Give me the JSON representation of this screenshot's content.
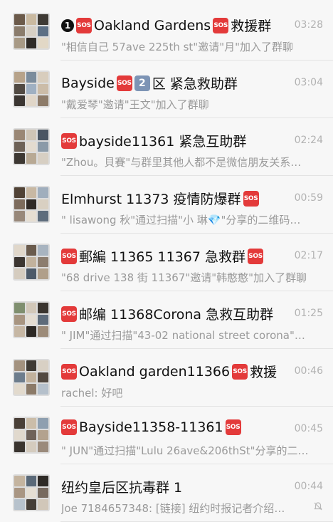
{
  "chats": [
    {
      "title_parts": [
        {
          "k": "circle",
          "t": "1"
        },
        {
          "k": "sos",
          "t": "SOS"
        },
        {
          "k": "text",
          "t": " Oakland Gardens"
        },
        {
          "k": "sos",
          "t": "SOS"
        },
        {
          "k": "text",
          "t": "救援群"
        }
      ],
      "preview": "\"相信自己 57ave 225th st\"邀请\"月\"加入了群聊",
      "time": "03:28"
    },
    {
      "title_parts": [
        {
          "k": "text",
          "t": "Bayside"
        },
        {
          "k": "sos",
          "t": "SOS"
        },
        {
          "k": "box",
          "t": "2"
        },
        {
          "k": "text",
          "t": "区 紧急救助群"
        }
      ],
      "preview": "\"戴爱琴\"邀请\"王文\"加入了群聊",
      "time": "03:04"
    },
    {
      "title_parts": [
        {
          "k": "sos",
          "t": "SOS"
        },
        {
          "k": "text",
          "t": "bayside11361 紧急互助群"
        }
      ],
      "preview": "\"Zhou。貝賽\"与群里其他人都不是微信朋友关系…",
      "time": "02:24"
    },
    {
      "title_parts": [
        {
          "k": "text",
          "t": "Elmhurst 11373 疫情防爆群"
        },
        {
          "k": "sos",
          "t": "SOS"
        }
      ],
      "preview": "\" lisawong 秋\"通过扫描\"小 琳💎\"分享的二维码…",
      "time": "00:59"
    },
    {
      "title_parts": [
        {
          "k": "sos",
          "t": "SOS"
        },
        {
          "k": "text",
          "t": "郵編 11365 11367 急救群"
        },
        {
          "k": "sos",
          "t": "SOS"
        }
      ],
      "preview": "\"68 drive 138 街 11367\"邀请\"韩憨憨\"加入了群聊",
      "time": "02:17"
    },
    {
      "title_parts": [
        {
          "k": "sos",
          "t": "SOS"
        },
        {
          "k": "text",
          "t": " 邮编 11368Corona 急救互助群"
        }
      ],
      "preview": "\" JIM\"通过扫描\"43-02 national street corona\"…",
      "time": "01:25"
    },
    {
      "title_parts": [
        {
          "k": "sos",
          "t": "SOS"
        },
        {
          "k": "text",
          "t": " Oakland garden11366"
        },
        {
          "k": "sos",
          "t": "SOS"
        },
        {
          "k": "text",
          "t": "救援"
        }
      ],
      "preview": "rachel: 好吧",
      "time": "00:46"
    },
    {
      "title_parts": [
        {
          "k": "sos",
          "t": "SOS"
        },
        {
          "k": "text",
          "t": " Bayside11358-11361"
        },
        {
          "k": "sos",
          "t": "SOS"
        }
      ],
      "preview": "\" JUN\"通过扫描\"Lulu 26ave&206thSt\"分享的二…",
      "time": "00:45"
    },
    {
      "title_parts": [
        {
          "k": "text",
          "t": "纽约皇后区抗毒群 1"
        }
      ],
      "preview": "Joe 7184657348: [链接] 纽约时报记者介绍…",
      "time": "00:44",
      "muted": true
    }
  ],
  "avatar_tiles": [
    [
      "#6b5a4a",
      "#c9b9a0",
      "#3e3a34",
      "#8a7c6c",
      "#d6cfc4",
      "#5c6f84",
      "#a89a86",
      "#2f2b27",
      "#e2d8c6"
    ],
    [
      "#b7a38a",
      "#7b8c9c",
      "#d8cdbd",
      "#514a43",
      "#9fb0c2",
      "#cbbca8",
      "#3b3632",
      "#e0d6c8",
      "#8d7b69"
    ],
    [
      "#9a8775",
      "#cfc5b6",
      "#4a5563",
      "#6e6257",
      "#e3dbcf",
      "#8b9aa8",
      "#3d3833",
      "#b8a994",
      "#d7cfc3"
    ],
    [
      "#514336",
      "#c8b8a3",
      "#a0aebd",
      "#7d6c5d",
      "#2f2a26",
      "#d9d0c2",
      "#98887a",
      "#e6ded2",
      "#5e6d7d"
    ],
    [
      "#e0d7ca",
      "#6a5b4d",
      "#a8b4c0",
      "#3c3631",
      "#c2b29d",
      "#8c7d6f",
      "#d5ccbf",
      "#4d5a69",
      "#b09f8a"
    ],
    [
      "#7f8f6f",
      "#d2c8b9",
      "#3a352f",
      "#a89581",
      "#e4ddd2",
      "#5d6b7a",
      "#c6b7a4",
      "#2d2925",
      "#9c8b79"
    ],
    [
      "#a3927f",
      "#3f3a34",
      "#d8d0c4",
      "#6d7d8d",
      "#c1b19c",
      "#514840",
      "#e2dacd",
      "#8b7a68",
      "#b5c0cb"
    ],
    [
      "#4a4038",
      "#cbbda9",
      "#8e9fb0",
      "#e1d9cd",
      "#70635a",
      "#b3a28e",
      "#39342f",
      "#d4cbbe",
      "#9a8a7b"
    ],
    [
      "#c4b49f",
      "#5a6978",
      "#2e2a26",
      "#a99683",
      "#e5ded3",
      "#776a5f",
      "#b7c2cc",
      "#463f38",
      "#d1c7b9"
    ]
  ]
}
